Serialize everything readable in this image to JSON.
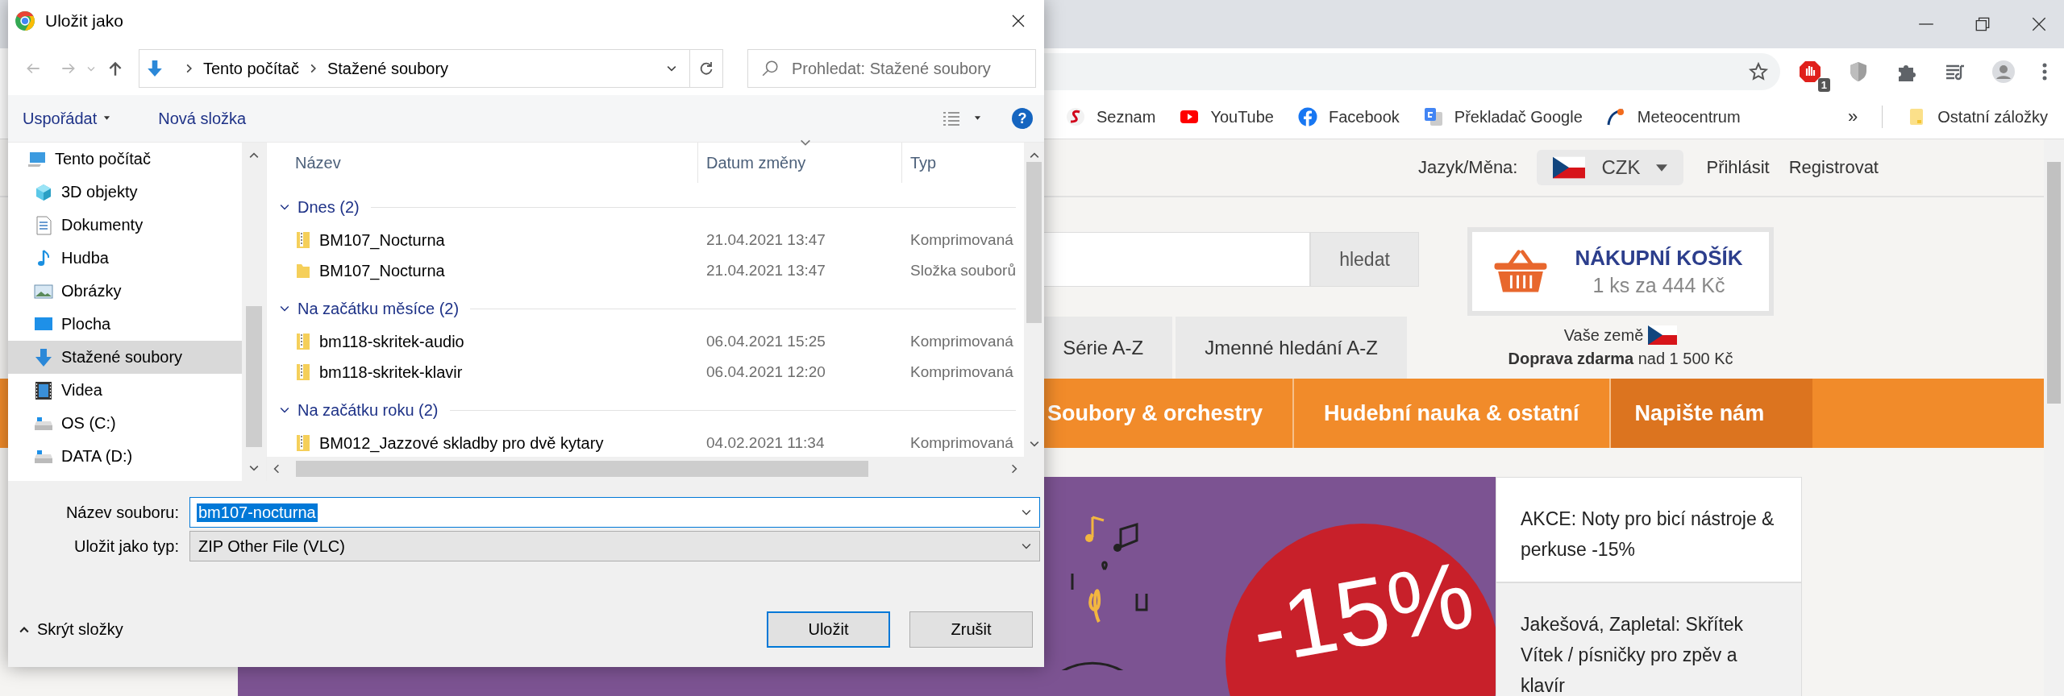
{
  "browser": {
    "extension_badge": "1",
    "bookmarks": [
      {
        "label": "Seznam",
        "kind": "seznam"
      },
      {
        "label": "YouTube",
        "kind": "youtube"
      },
      {
        "label": "Facebook",
        "kind": "facebook"
      },
      {
        "label": "Překladač Google",
        "kind": "translate"
      },
      {
        "label": "Meteocentrum",
        "kind": "meteo"
      }
    ],
    "bookmarks_overflow": "»",
    "other_bookmarks": "Ostatní záložky"
  },
  "page": {
    "header": {
      "lang_label": "Jazyk/Měna:",
      "currency": "CZK",
      "login": "Přihlásit",
      "register": "Registrovat"
    },
    "search_button": "hledat",
    "cart": {
      "title": "NÁKUPNÍ KOŠÍK",
      "summary": "1 ks za 444 Kč"
    },
    "country_label": "Vaše země",
    "shipping": "**Doprava zdarma** nad 1 500 Kč",
    "tabs": [
      {
        "label": "Série A-Z"
      },
      {
        "label": "Jmenné hledání A-Z"
      }
    ],
    "nav": [
      {
        "label": "Soubory & orchestry",
        "highlighted": false
      },
      {
        "label": "Hudební nauka & ostatní",
        "highlighted": false
      },
      {
        "label": "Napište nám",
        "highlighted": true
      }
    ],
    "banner": {
      "discount": "-15%"
    },
    "news": [
      {
        "text": "AKCE: Noty pro bicí nástroje & perkuse -15%",
        "shaded": false
      },
      {
        "text": "Jakešová, Zapletal: Skřítek Vítek / písničky pro zpěv a klavír",
        "shaded": true
      }
    ]
  },
  "dialog": {
    "title": "Uložit jako",
    "path": [
      "Tento počítač",
      "Stažené soubory"
    ],
    "search_placeholder": "Prohledat: Stažené soubory",
    "organize": "Uspořádat",
    "new_folder": "Nová složka",
    "help": "?",
    "sidebar": [
      {
        "label": "Tento počítač",
        "kind": "computer",
        "selected": false,
        "children": [
          {
            "label": "3D objekty",
            "kind": "cube",
            "selected": false
          },
          {
            "label": "Dokumenty",
            "kind": "document",
            "selected": false
          },
          {
            "label": "Hudba",
            "kind": "music",
            "selected": false
          },
          {
            "label": "Obrázky",
            "kind": "pictures",
            "selected": false
          },
          {
            "label": "Plocha",
            "kind": "desktop",
            "selected": false
          },
          {
            "label": "Stažené soubory",
            "kind": "download",
            "selected": true
          },
          {
            "label": "Videa",
            "kind": "video",
            "selected": false
          },
          {
            "label": "OS (C:)",
            "kind": "drive",
            "selected": false
          },
          {
            "label": "DATA (D:)",
            "kind": "drive",
            "selected": false
          }
        ]
      }
    ],
    "columns": [
      {
        "label": "Název",
        "sorted": false
      },
      {
        "label": "Datum změny",
        "sorted": true
      },
      {
        "label": "Typ",
        "sorted": false
      }
    ],
    "groups": [
      {
        "label": "Dnes (2)",
        "expanded": true,
        "files": [
          {
            "name": "BM107_Nocturna",
            "date": "21.04.2021 13:47",
            "type": "Komprimovaná",
            "kind": "zip"
          },
          {
            "name": "BM107_Nocturna",
            "date": "21.04.2021 13:47",
            "type": "Složka souborů",
            "kind": "folder"
          }
        ]
      },
      {
        "label": "Na začátku měsíce (2)",
        "expanded": true,
        "files": [
          {
            "name": "bm118-skritek-audio",
            "date": "06.04.2021 15:25",
            "type": "Komprimovaná",
            "kind": "zip"
          },
          {
            "name": "bm118-skritek-klavir",
            "date": "06.04.2021 12:20",
            "type": "Komprimovaná",
            "kind": "zip"
          }
        ]
      },
      {
        "label": "Na začátku roku (2)",
        "expanded": true,
        "files": [
          {
            "name": "BM012_Jazzové skladby pro dvě kytary",
            "date": "04.02.2021 11:34",
            "type": "Komprimovaná",
            "kind": "zip"
          }
        ]
      }
    ],
    "filename_label": "Název souboru:",
    "filename": "bm107-nocturna",
    "filename_selected": true,
    "filetype_label": "Uložit jako typ:",
    "filetype": "ZIP Other File (VLC)",
    "hide_folders": "Skrýt složky",
    "buttons": [
      {
        "label": "Uložit",
        "default": true
      },
      {
        "label": "Zrušit",
        "default": false
      }
    ]
  }
}
